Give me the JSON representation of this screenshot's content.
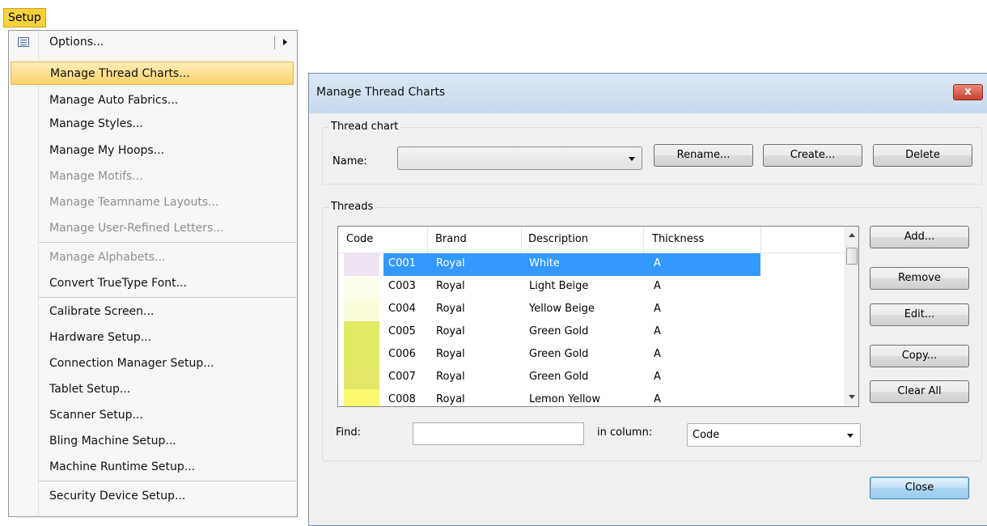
{
  "menu": {
    "title": "Setup",
    "items": [
      {
        "label": "Options...",
        "enabled": true
      },
      {
        "label": "Manage Thread Charts...",
        "enabled": true
      },
      {
        "label": "Manage Auto Fabrics...",
        "enabled": true
      },
      {
        "label": "Manage Styles...",
        "enabled": true
      },
      {
        "label": "Manage My Hoops...",
        "enabled": true
      },
      {
        "label": "Manage Motifs...",
        "enabled": false
      },
      {
        "label": "Manage Teamname Layouts...",
        "enabled": false
      },
      {
        "label": "Manage User-Refined Letters...",
        "enabled": false
      },
      {
        "label": "Manage Alphabets...",
        "enabled": false
      },
      {
        "label": "Convert TrueType Font...",
        "enabled": true
      },
      {
        "label": "Calibrate Screen...",
        "enabled": true
      },
      {
        "label": "Hardware Setup...",
        "enabled": true
      },
      {
        "label": "Connection Manager Setup...",
        "enabled": true
      },
      {
        "label": "Tablet Setup...",
        "enabled": true
      },
      {
        "label": "Scanner Setup...",
        "enabled": true
      },
      {
        "label": "Bling Machine Setup...",
        "enabled": true
      },
      {
        "label": "Machine Runtime Setup...",
        "enabled": true
      },
      {
        "label": "Security Device Setup...",
        "enabled": true
      }
    ]
  },
  "dialog": {
    "title": "Manage Thread Charts",
    "close_glyph": "x",
    "thread_chart": {
      "legend": "Thread chart",
      "name_label": "Name:",
      "name_value": "",
      "rename_label": "Rename...",
      "create_label": "Create...",
      "delete_label": "Delete"
    },
    "threads": {
      "legend": "Threads",
      "columns": [
        "Code",
        "Brand",
        "Description",
        "Thickness"
      ],
      "rows": [
        {
          "color": "#efe3f3",
          "code": "C001",
          "brand": "Royal",
          "description": "White",
          "thickness": "A"
        },
        {
          "color": "#fdfdee",
          "code": "C003",
          "brand": "Royal",
          "description": "Light Beige",
          "thickness": "A"
        },
        {
          "color": "#fcfbdc",
          "code": "C004",
          "brand": "Royal",
          "description": "Yellow Beige",
          "thickness": "A"
        },
        {
          "color": "#e2eb63",
          "code": "C005",
          "brand": "Royal",
          "description": "Green Gold",
          "thickness": "A"
        },
        {
          "color": "#e2eb63",
          "code": "C006",
          "brand": "Royal",
          "description": "Green Gold",
          "thickness": "A"
        },
        {
          "color": "#e4e86b",
          "code": "C007",
          "brand": "Royal",
          "description": "Green Gold",
          "thickness": "A"
        },
        {
          "color": "#fbfa6e",
          "code": "C008",
          "brand": "Royal",
          "description": "Lemon Yellow",
          "thickness": "A"
        }
      ],
      "selected_row": "C001",
      "add_label": "Add...",
      "remove_label": "Remove",
      "edit_label": "Edit...",
      "copy_label": "Copy...",
      "clear_all_label": "Clear All"
    },
    "find": {
      "label": "Find:",
      "value": "",
      "column_label": "in column:",
      "column_value": "Code"
    },
    "close_label": "Close"
  }
}
